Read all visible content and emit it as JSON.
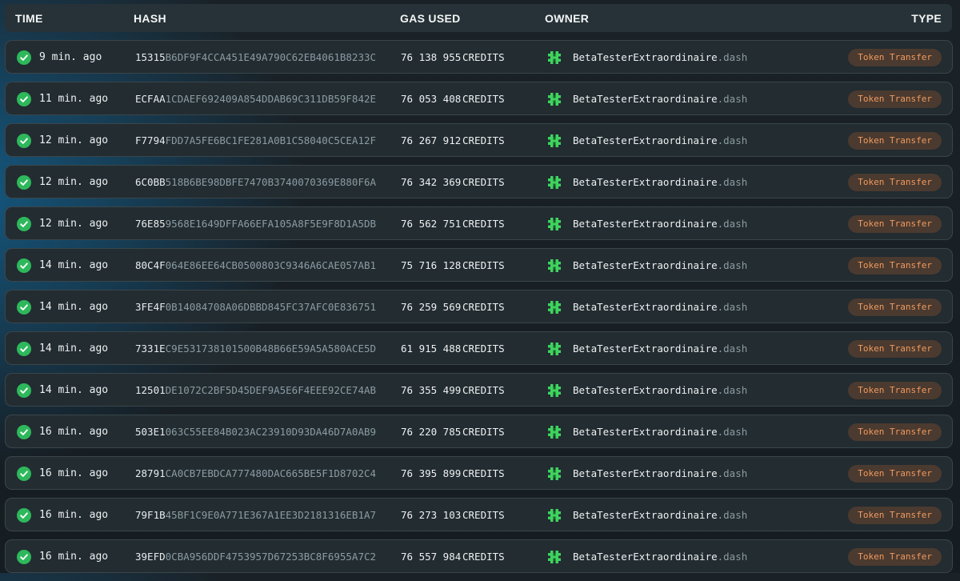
{
  "columns": {
    "time": "TIME",
    "hash": "HASH",
    "gas": "GAS USED",
    "owner": "OWNER",
    "type": "TYPE"
  },
  "colors": {
    "accent_green": "#2eb85c",
    "badge_bg": "#4b3a2f",
    "badge_text": "#f09a5f",
    "hash_rest": "#8c9ba3"
  },
  "icons": {
    "status": "check-circle-icon",
    "owner": "identicon-avatar-icon"
  },
  "transactions": [
    {
      "time": "9 min. ago",
      "hash_prefix": "15315",
      "hash_rest": "B6DF9F4CCA451E49A790C62EB4061B8233C",
      "gas": "76 138 955",
      "unit": "CREDITS",
      "owner_name": "BetaTesterExtraordinaire",
      "owner_domain": ".dash",
      "type": "Token Transfer"
    },
    {
      "time": "11 min. ago",
      "hash_prefix": "ECFAA",
      "hash_rest": "1CDAEF692409A854DDAB69C311DB59F842E",
      "gas": "76 053 408",
      "unit": "CREDITS",
      "owner_name": "BetaTesterExtraordinaire",
      "owner_domain": ".dash",
      "type": "Token Transfer"
    },
    {
      "time": "12 min. ago",
      "hash_prefix": "F7794",
      "hash_rest": "FDD7A5FE6BC1FE281A0B1C58040C5CEA12F",
      "gas": "76 267 912",
      "unit": "CREDITS",
      "owner_name": "BetaTesterExtraordinaire",
      "owner_domain": ".dash",
      "type": "Token Transfer"
    },
    {
      "time": "12 min. ago",
      "hash_prefix": "6C0BB",
      "hash_rest": "518B6BE98DBFE7470B3740070369E880F6A",
      "gas": "76 342 369",
      "unit": "CREDITS",
      "owner_name": "BetaTesterExtraordinaire",
      "owner_domain": ".dash",
      "type": "Token Transfer"
    },
    {
      "time": "12 min. ago",
      "hash_prefix": "76E85",
      "hash_rest": "9568E1649DFFA66EFA105A8F5E9F8D1A5DB",
      "gas": "76 562 751",
      "unit": "CREDITS",
      "owner_name": "BetaTesterExtraordinaire",
      "owner_domain": ".dash",
      "type": "Token Transfer"
    },
    {
      "time": "14 min. ago",
      "hash_prefix": "80C4F",
      "hash_rest": "064E86EE64CB0500803C9346A6CAE057AB1",
      "gas": "75 716 128",
      "unit": "CREDITS",
      "owner_name": "BetaTesterExtraordinaire",
      "owner_domain": ".dash",
      "type": "Token Transfer"
    },
    {
      "time": "14 min. ago",
      "hash_prefix": "3FE4F",
      "hash_rest": "0B14084708A06DBBD845FC37AFC0E836751",
      "gas": "76 259 569",
      "unit": "CREDITS",
      "owner_name": "BetaTesterExtraordinaire",
      "owner_domain": ".dash",
      "type": "Token Transfer"
    },
    {
      "time": "14 min. ago",
      "hash_prefix": "7331E",
      "hash_rest": "C9E531738101500B48B66E59A5A580ACE5D",
      "gas": "61 915 488",
      "unit": "CREDITS",
      "owner_name": "BetaTesterExtraordinaire",
      "owner_domain": ".dash",
      "type": "Token Transfer"
    },
    {
      "time": "14 min. ago",
      "hash_prefix": "12501",
      "hash_rest": "DE1072C2BF5D45DEF9A5E6F4EEE92CE74AB",
      "gas": "76 355 499",
      "unit": "CREDITS",
      "owner_name": "BetaTesterExtraordinaire",
      "owner_domain": ".dash",
      "type": "Token Transfer"
    },
    {
      "time": "16 min. ago",
      "hash_prefix": "503E1",
      "hash_rest": "063C55EE84B023AC23910D93DA46D7A0AB9",
      "gas": "76 220 785",
      "unit": "CREDITS",
      "owner_name": "BetaTesterExtraordinaire",
      "owner_domain": ".dash",
      "type": "Token Transfer"
    },
    {
      "time": "16 min. ago",
      "hash_prefix": "28791",
      "hash_rest": "CA0CB7EBDCA777480DAC665BE5F1D8702C4",
      "gas": "76 395 899",
      "unit": "CREDITS",
      "owner_name": "BetaTesterExtraordinaire",
      "owner_domain": ".dash",
      "type": "Token Transfer"
    },
    {
      "time": "16 min. ago",
      "hash_prefix": "79F1B",
      "hash_rest": "45BF1C9E0A771E367A1EE3D2181316EB1A7",
      "gas": "76 273 103",
      "unit": "CREDITS",
      "owner_name": "BetaTesterExtraordinaire",
      "owner_domain": ".dash",
      "type": "Token Transfer"
    },
    {
      "time": "16 min. ago",
      "hash_prefix": "39EFD",
      "hash_rest": "0CBA956DDF4753957D67253BC8F6955A7C2",
      "gas": "76 557 984",
      "unit": "CREDITS",
      "owner_name": "BetaTesterExtraordinaire",
      "owner_domain": ".dash",
      "type": "Token Transfer"
    }
  ]
}
